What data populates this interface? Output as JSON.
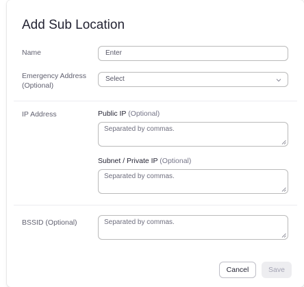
{
  "dialog": {
    "title": "Add Sub Location"
  },
  "fields": {
    "name": {
      "label": "Name",
      "placeholder": "Enter"
    },
    "emergency_address": {
      "label_line1": "Emergency Address",
      "label_line2": "(Optional)",
      "value": "Select"
    },
    "ip_address": {
      "label": "IP Address",
      "public_ip": {
        "label": "Public IP",
        "optional": "(Optional)",
        "placeholder": "Separated by commas."
      },
      "subnet_private_ip": {
        "label": "Subnet / Private IP",
        "optional": "(Optional)",
        "placeholder": "Separated by commas."
      }
    },
    "bssid": {
      "label": "BSSID (Optional)",
      "placeholder": "Separated by commas."
    }
  },
  "actions": {
    "cancel_label": "Cancel",
    "save_label": "Save"
  },
  "icons": {
    "select_chevron": "chevron-down-icon",
    "resize_grip": "resize-grip-icon"
  },
  "colors": {
    "border": "#bababa",
    "save_disabled_bg": "#ededf0",
    "save_disabled_text": "#a3a3b3"
  }
}
